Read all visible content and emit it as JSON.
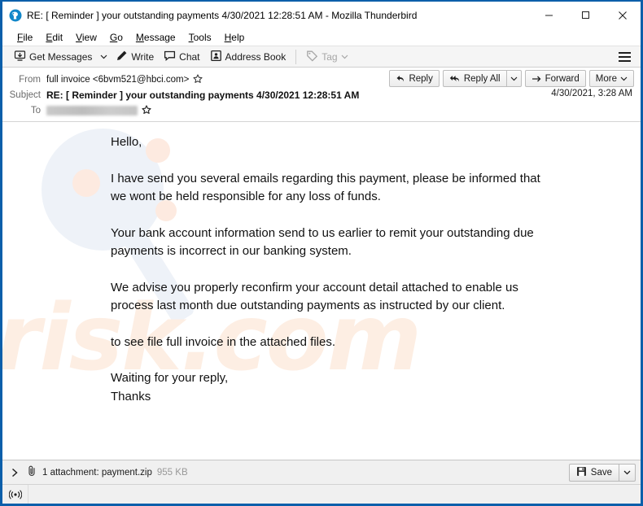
{
  "window": {
    "title": "RE: [ Reminder ] your outstanding payments 4/30/2021 12:28:51 AM - Mozilla Thunderbird",
    "app_icon": "thunderbird-icon",
    "minimize_label": "─",
    "maximize_label": "□",
    "close_label": "✕",
    "border_color": "#0b5faa"
  },
  "menu": {
    "items": [
      {
        "label": "File",
        "accesskey": "F"
      },
      {
        "label": "Edit",
        "accesskey": "E"
      },
      {
        "label": "View",
        "accesskey": "V"
      },
      {
        "label": "Go",
        "accesskey": "G"
      },
      {
        "label": "Message",
        "accesskey": "M"
      },
      {
        "label": "Tools",
        "accesskey": "T"
      },
      {
        "label": "Help",
        "accesskey": "H"
      }
    ]
  },
  "toolbar": {
    "get_messages": "Get Messages",
    "write": "Write",
    "chat": "Chat",
    "address_book": "Address Book",
    "tag": "Tag",
    "app_menu_icon": "hamburger-icon"
  },
  "message_header": {
    "from_label": "From",
    "from_value": "full invoice <6bvm521@hbci.com>",
    "subject_label": "Subject",
    "subject_value": "RE: [ Reminder ] your outstanding payments 4/30/2021 12:28:51 AM",
    "to_label": "To",
    "to_value": "",
    "to_redacted": true,
    "date": "4/30/2021, 3:28 AM",
    "star_icon": "star-outline-icon",
    "actions": {
      "reply": "Reply",
      "reply_all": "Reply All",
      "forward": "Forward",
      "more": "More"
    }
  },
  "body": {
    "paragraphs": [
      "Hello,",
      "I have send you several emails regarding this payment, please be informed that we wont be held responsible for any loss of funds.",
      "Your bank account information send to us earlier to remit your outstanding due payments is incorrect in our banking system.",
      "We advise you properly reconfirm your account detail attached to enable us process last month due outstanding payments as instructed by our client.",
      "to see file full invoice in the attached files.",
      "Waiting for your reply,\nThanks"
    ],
    "watermark_text": "risk.com",
    "watermark_color": "#fdeee3",
    "watermark_glass_color": "#eef2f8"
  },
  "attachment": {
    "expand_icon": "chevron-right-icon",
    "paperclip_icon": "paperclip-icon",
    "summary": "1 attachment: payment.zip",
    "size": "955 KB",
    "save_label": "Save",
    "save_icon": "floppy-disk-icon"
  },
  "status_bar": {
    "icon": "broadcast-icon",
    "icon_glyph": "((•))"
  }
}
